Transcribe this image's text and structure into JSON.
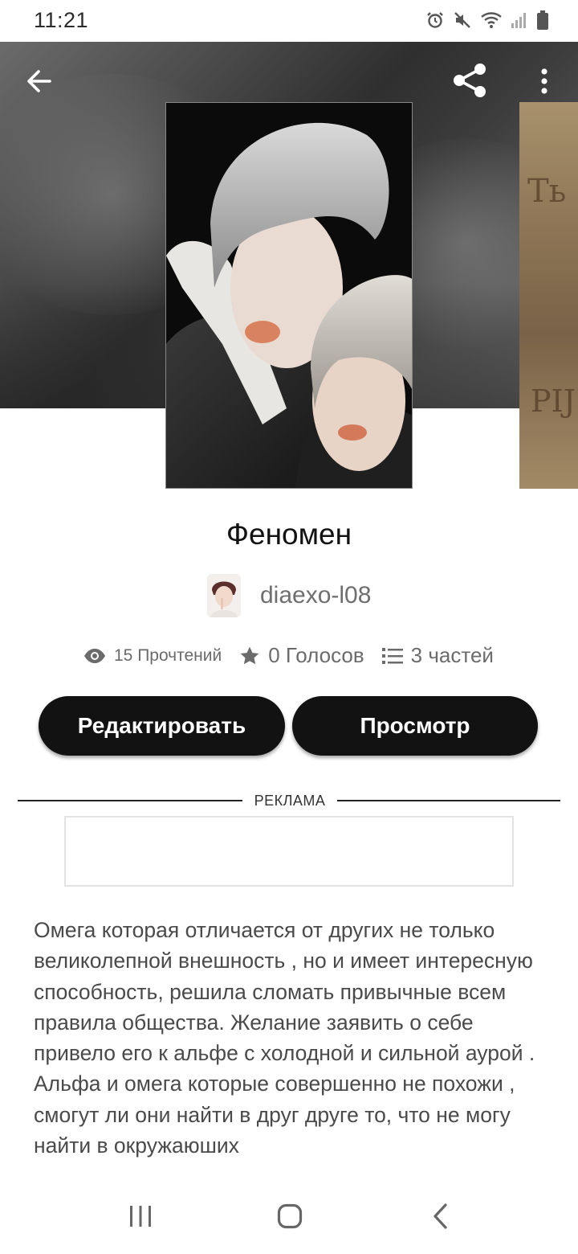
{
  "status_bar": {
    "time": "11:21",
    "icons": [
      "alarm-icon",
      "mute-icon",
      "wifi-icon",
      "signal-icon",
      "battery-icon"
    ]
  },
  "header": {
    "icons": [
      "back-arrow-icon",
      "share-icon",
      "more-vert-icon"
    ]
  },
  "cover": {
    "next_cover_text_top": "Ть",
    "next_cover_text_bottom": "PIJ"
  },
  "story": {
    "title": "Феномен",
    "author": "diaexo-l08",
    "stats": {
      "views": "15 Прочтений",
      "votes": "0 Голосов",
      "parts": "3 частей"
    },
    "description": "Омега которая отличается от других не только великолепной внешность , но и имеет интересную способность, решила сломать привычные всем правила общества. Желание заявить о себе привело его к альфе с холодной и сильной аурой . Альфа и омега которые совершенно не похожи , смогут ли они найти в друг друге то, что не могу найти в окружаюших"
  },
  "actions": {
    "edit_label": "Редактировать",
    "view_label": "Просмотр"
  },
  "ad": {
    "label": "РЕКЛАМА"
  },
  "nav_bar": {
    "icons": [
      "recent-apps-icon",
      "home-icon",
      "back-icon"
    ]
  },
  "colors": {
    "button_bg": "#121212",
    "button_text": "#ffffff",
    "text_primary": "#121212",
    "text_secondary": "#6b6b6b"
  }
}
